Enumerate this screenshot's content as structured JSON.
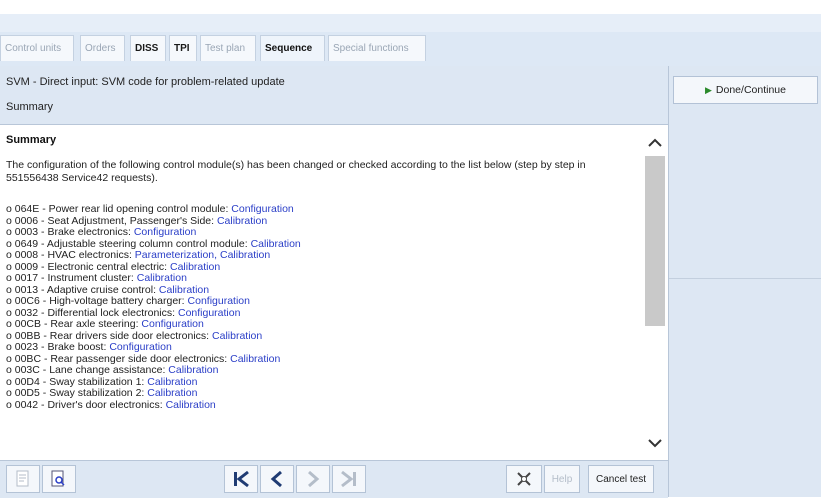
{
  "tabs": [
    {
      "label": "Control units",
      "state": "inactive"
    },
    {
      "label": "Orders",
      "state": "inactive"
    },
    {
      "label": "DISS",
      "state": "bold"
    },
    {
      "label": "TPI",
      "state": "bold"
    },
    {
      "label": "Test plan",
      "state": "inactive"
    },
    {
      "label": "Sequence",
      "state": "active"
    },
    {
      "label": "Special functions",
      "state": "inactive"
    }
  ],
  "header": {
    "title": "SVM - Direct input: SVM code for problem-related update",
    "subtitle": "Summary"
  },
  "content": {
    "heading": "Summary",
    "intro": "The configuration of the following control module(s) has been changed or checked according to the list below (step by step in 551556438 Service42 requests).",
    "items": [
      {
        "text": "o 064E - Power rear lid opening control module: ",
        "action": "Configuration"
      },
      {
        "text": "o 0006 - Seat Adjustment, Passenger's Side: ",
        "action": "Calibration"
      },
      {
        "text": "o 0003 - Brake electronics: ",
        "action": "Configuration"
      },
      {
        "text": "o 0649 - Adjustable steering column control module: ",
        "action": "Calibration"
      },
      {
        "text": "o 0008 - HVAC electronics: ",
        "action": "Parameterization, Calibration"
      },
      {
        "text": "o 0009 - Electronic central electric: ",
        "action": "Calibration"
      },
      {
        "text": "o 0017 - Instrument cluster: ",
        "action": "Calibration"
      },
      {
        "text": "o 0013 - Adaptive cruise control: ",
        "action": "Calibration"
      },
      {
        "text": "o 00C6 - High-voltage battery charger: ",
        "action": "Configuration"
      },
      {
        "text": "o 0032 - Differential lock electronics: ",
        "action": "Configuration"
      },
      {
        "text": "o 00CB - Rear axle steering: ",
        "action": "Configuration"
      },
      {
        "text": "o 00BB - Rear drivers side door electronics: ",
        "action": "Calibration"
      },
      {
        "text": "o 0023 - Brake boost: ",
        "action": "Configuration"
      },
      {
        "text": "o 00BC - Rear passenger side door electronics: ",
        "action": "Calibration"
      },
      {
        "text": "o 003C - Lane change assistance: ",
        "action": "Calibration"
      },
      {
        "text": "o 00D4 - Sway stabilization 1: ",
        "action": "Calibration"
      },
      {
        "text": "o 00D5 - Sway stabilization 2: ",
        "action": "Calibration"
      },
      {
        "text": "o 0042 - Driver's door electronics: ",
        "action": "Calibration"
      }
    ]
  },
  "toolbar": {
    "help_label": "Help",
    "cancel_label": "Cancel test"
  },
  "side": {
    "done_label": "Done/Continue"
  },
  "colors": {
    "accent_link": "#2a3ec7",
    "panel_bg": "#dde7f3"
  }
}
